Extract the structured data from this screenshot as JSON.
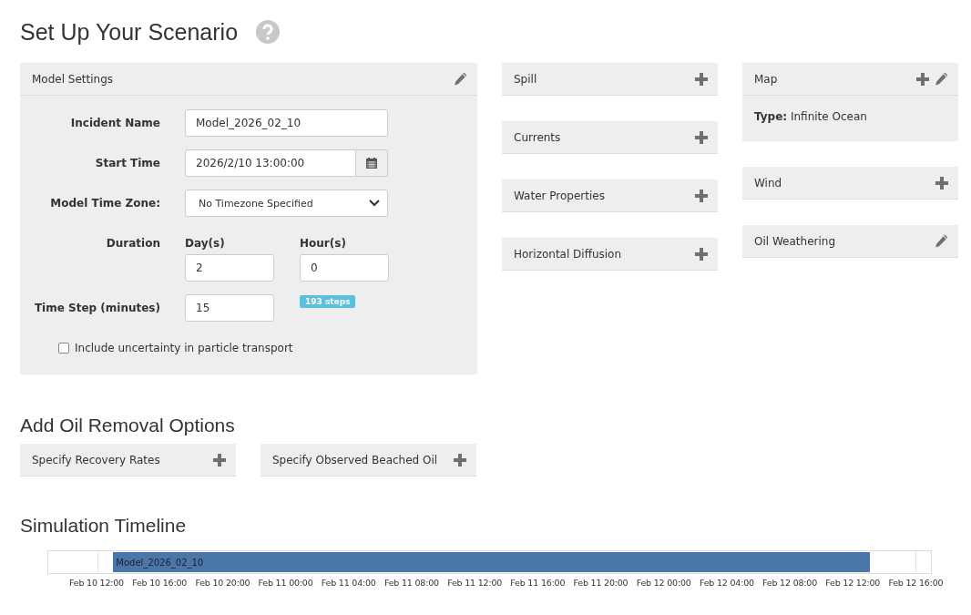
{
  "page_title": "Set Up Your Scenario",
  "model_settings": {
    "title": "Model Settings",
    "incident_name": {
      "label": "Incident Name",
      "value": "Model_2026_02_10"
    },
    "start_time": {
      "label": "Start Time",
      "value": "2026/2/10 13:00:00"
    },
    "time_zone": {
      "label": "Model Time Zone:",
      "value": "No Timezone Specified"
    },
    "duration": {
      "label": "Duration",
      "days_label": "Day(s)",
      "days": "2",
      "hours_label": "Hour(s)",
      "hours": "0"
    },
    "time_step": {
      "label": "Time Step (minutes)",
      "value": "15",
      "steps_badge": "193 steps"
    },
    "uncertainty": {
      "label": "Include uncertainty in particle transport",
      "checked": false
    }
  },
  "middle_panels": [
    {
      "title": "Spill",
      "add": true,
      "edit": false
    },
    {
      "title": "Currents",
      "add": true,
      "edit": false
    },
    {
      "title": "Water Properties",
      "add": true,
      "edit": false
    },
    {
      "title": "Horizontal Diffusion",
      "add": true,
      "edit": false
    }
  ],
  "right_panels": [
    {
      "title": "Map",
      "add": true,
      "edit": true,
      "body": "**Type:** Infinite Ocean"
    },
    {
      "title": "Wind",
      "add": true,
      "edit": false
    },
    {
      "title": "Oil Weathering",
      "add": false,
      "edit": true
    }
  ],
  "removal": {
    "title": "Add Oil Removal Options",
    "panels": [
      {
        "title": "Specify Recovery Rates",
        "add": true,
        "edit": false
      },
      {
        "title": "Specify Observed Beached Oil",
        "add": true,
        "edit": false
      }
    ]
  },
  "timeline": {
    "title": "Simulation Timeline",
    "bar_label": "Model_2026_02_10",
    "ticks": [
      "Feb 10 12:00",
      "Feb 10 16:00",
      "Feb 10 20:00",
      "Feb 11 00:00",
      "Feb 11 04:00",
      "Feb 11 08:00",
      "Feb 11 12:00",
      "Feb 11 16:00",
      "Feb 11 20:00",
      "Feb 12 00:00",
      "Feb 12 04:00",
      "Feb 12 08:00",
      "Feb 12 12:00",
      "Feb 12 16:00"
    ]
  }
}
